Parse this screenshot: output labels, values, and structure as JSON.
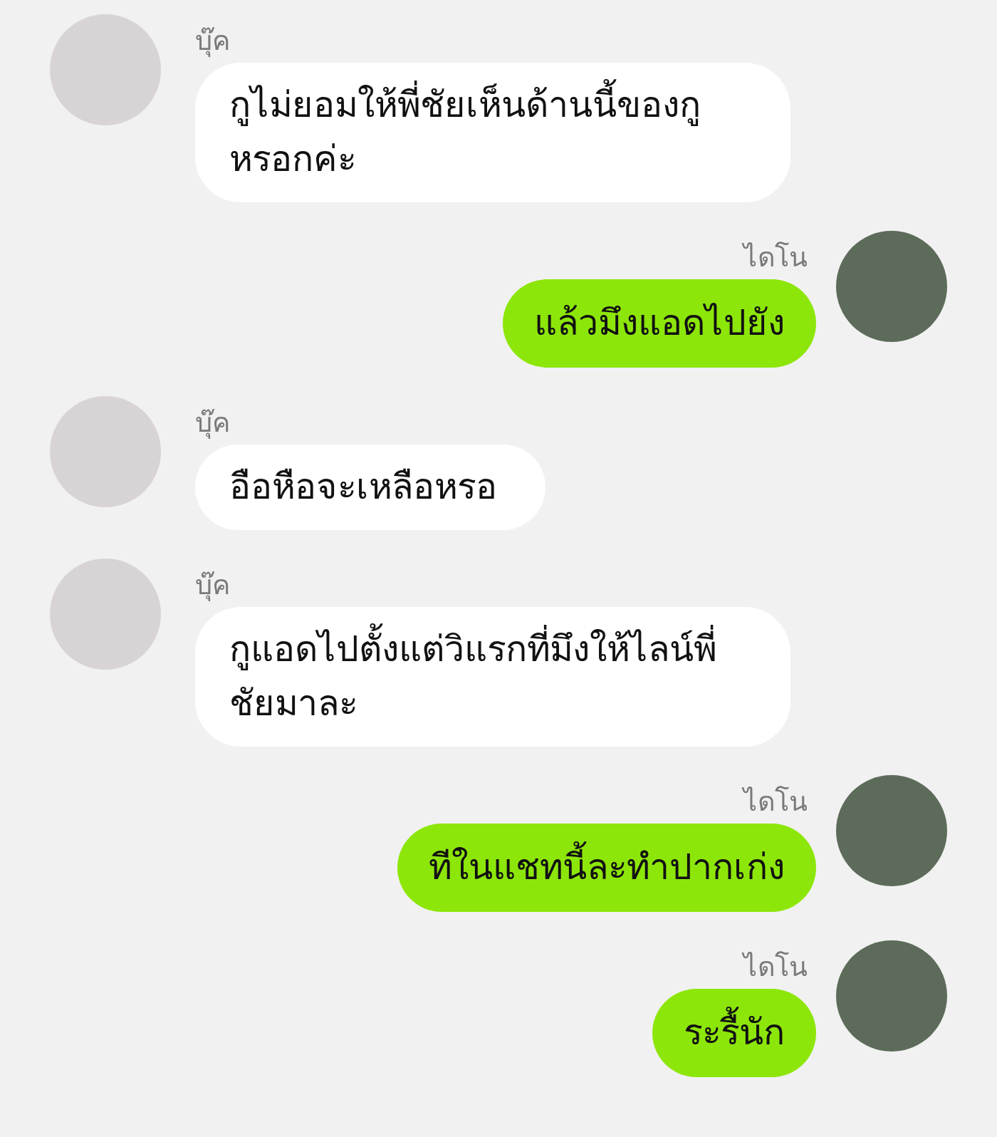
{
  "messages": [
    {
      "kind": "received",
      "sender": "บุ๊ค",
      "text": "กูไม่ยอมให้พี่ชัยเห็นด้านนี้ของกูหรอกค่ะ"
    },
    {
      "kind": "sent",
      "sender": "ไดโน",
      "text": "แล้วมึงแอดไปยัง"
    },
    {
      "kind": "received",
      "sender": "บุ๊ค",
      "text": "อือหือจะเหลือหรอ"
    },
    {
      "kind": "received",
      "sender": "บุ๊ค",
      "text": "กูแอดไปตั้งแต่วิแรกที่มึงให้ไลน์พี่ชัยมาละ"
    },
    {
      "kind": "sent",
      "sender": "ไดโน",
      "text": "ทีในแชทนี้ละทำปากเก่ง"
    },
    {
      "kind": "sent",
      "sender": "ไดโน",
      "text": "ระรื้นัก"
    }
  ]
}
